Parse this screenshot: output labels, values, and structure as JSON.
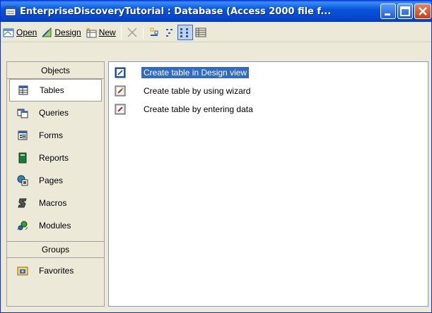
{
  "window": {
    "title": "EnterpriseDiscoveryTutorial : Database (Access 2000 file f..."
  },
  "toolbar": {
    "open_label": "Open",
    "design_label": "Design",
    "new_label": "New",
    "open_mnemonic": "O",
    "design_mnemonic": "D",
    "new_mnemonic": "N"
  },
  "objects_bar": {
    "objects_header": "Objects",
    "items": [
      {
        "label": "Tables",
        "icon": "table-icon"
      },
      {
        "label": "Queries",
        "icon": "query-icon"
      },
      {
        "label": "Forms",
        "icon": "form-icon"
      },
      {
        "label": "Reports",
        "icon": "report-icon"
      },
      {
        "label": "Pages",
        "icon": "page-icon"
      },
      {
        "label": "Macros",
        "icon": "macro-icon"
      },
      {
        "label": "Modules",
        "icon": "module-icon"
      }
    ],
    "groups_header": "Groups",
    "groups": [
      {
        "label": "Favorites",
        "icon": "favorites-folder-icon"
      }
    ],
    "selected": "Tables"
  },
  "list": {
    "items": [
      {
        "label": "Create table in Design view",
        "selected": true
      },
      {
        "label": "Create table by using wizard",
        "selected": false
      },
      {
        "label": "Create table by entering data",
        "selected": false
      }
    ]
  },
  "colors": {
    "titlebar": "#0855dd",
    "selection": "#316ac5",
    "window_bg": "#ece9d8"
  }
}
